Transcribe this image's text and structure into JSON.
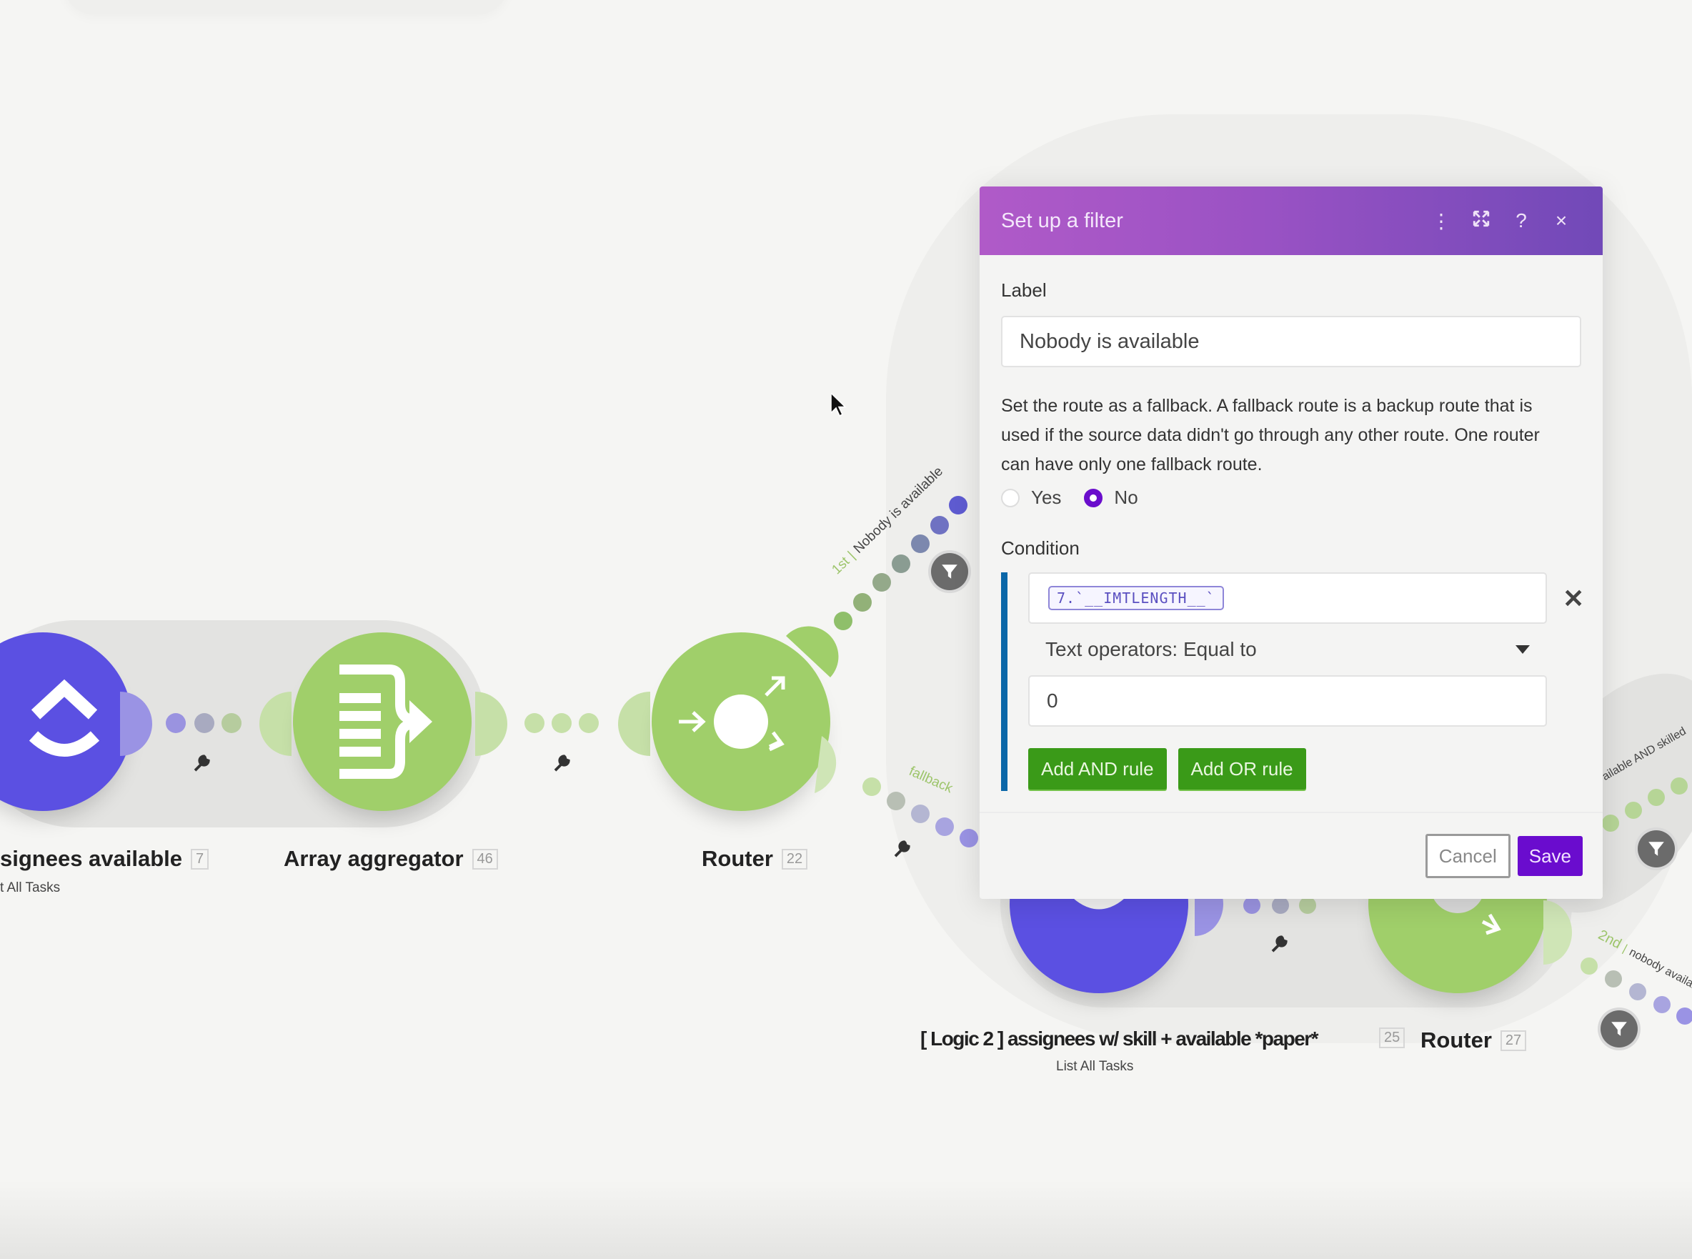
{
  "scenario": {
    "nodes": [
      {
        "label": "signees available",
        "id": "7",
        "subtitle": "t All Tasks"
      },
      {
        "label": "Array aggregator",
        "id": "46"
      },
      {
        "label": "Router",
        "id": "22"
      },
      {
        "label": "[ Logic 2 ] assignees w/ skill + available *paper*",
        "id": "25",
        "subtitle": "List All Tasks"
      },
      {
        "label": "Router",
        "id": "27"
      }
    ],
    "routes": [
      {
        "order": "1st",
        "label": "Nobody is available"
      },
      {
        "order": "",
        "label": "fallback"
      },
      {
        "order": "",
        "label": "ailable AND skilled"
      },
      {
        "order": "2nd",
        "label": "nobody available a"
      }
    ]
  },
  "dialog": {
    "title": "Set up a filter",
    "header_icons": [
      "more-vertical-icon",
      "expand-icon",
      "help-icon",
      "close-icon"
    ],
    "label_field": {
      "label": "Label",
      "value": "Nobody is available"
    },
    "fallback_help": "Set the route as a fallback. A fallback route is a backup route that is used if the source data didn't go through any other route. One router can have only one fallback route.",
    "fallback_options": [
      {
        "label": "Yes",
        "selected": false
      },
      {
        "label": "No",
        "selected": true
      }
    ],
    "condition": {
      "label": "Condition",
      "operand": "7.`__IMTLENGTH__`",
      "operator": "Text operators: Equal to",
      "value": "0",
      "add_and": "Add AND rule",
      "add_or": "Add OR rule"
    },
    "cancel": "Cancel",
    "save": "Save"
  },
  "colors": {
    "accent_purple": "#6a0cce",
    "header_gradient_start": "#b05ac8",
    "header_gradient_end": "#7149b8",
    "module_green": "#a0cf6a",
    "clickup_blue": "#5b50e2",
    "rule_button_green": "#3a9a18",
    "condition_bar_blue": "#0b67a8"
  }
}
